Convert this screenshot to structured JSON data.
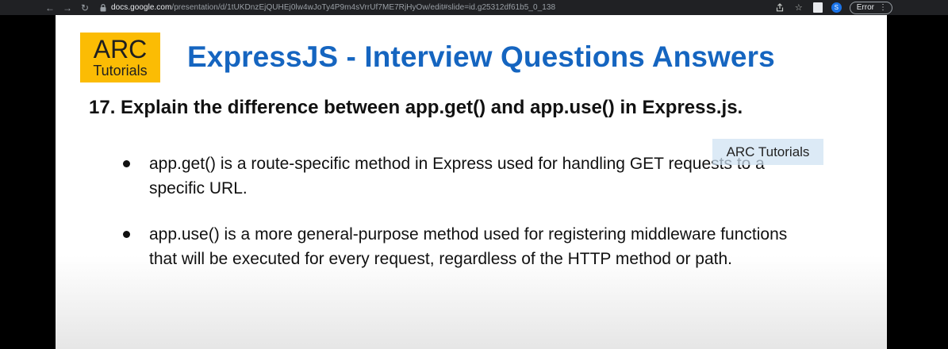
{
  "browser": {
    "url_domain": "docs.google.com",
    "url_path": "/presentation/d/1tUKDnzEjQUHEj0lw4wJoTy4P9m4sVrrUf7ME7RjHyOw/edit#slide=id.g25312df61b5_0_138",
    "profile_initial": "S",
    "status_label": "Error",
    "icons": {
      "back": "arrow-left-icon",
      "forward": "arrow-right-icon",
      "reload": "reload-icon",
      "lock": "lock-icon",
      "share": "share-icon",
      "bookmark": "star-icon",
      "sidepanel": "side-panel-icon",
      "menu": "kebab-menu-icon"
    },
    "colors": {
      "bar_bg": "#202124",
      "avatar": "#1a73e8"
    }
  },
  "slide": {
    "logo": {
      "main": "ARC",
      "sub": "Tutorials",
      "bg_color": "#fbbc04"
    },
    "title": "ExpressJS - Interview Questions Answers",
    "title_color": "#1565c0",
    "question": "17. Explain the difference between app.get() and app.use() in Express.js.",
    "bullets": [
      {
        "text": "app.get() is a route-specific method in Express used for handling GET requests to a specific URL."
      },
      {
        "text": "app.use() is a more general-purpose method used for registering middleware functions that will be executed for every request, regardless of the HTTP method or path."
      }
    ],
    "watermark": "ARC Tutorials"
  }
}
